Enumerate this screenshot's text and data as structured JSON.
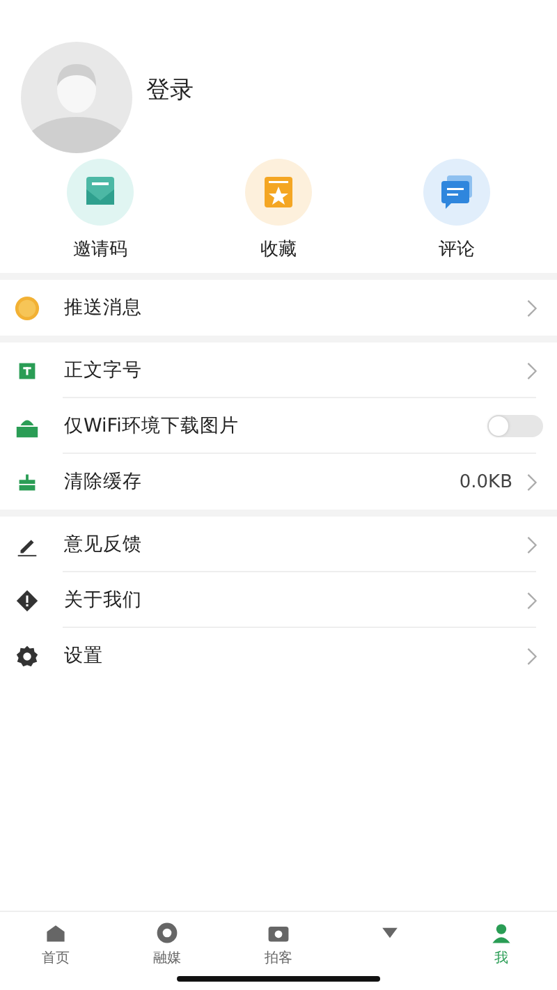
{
  "profile": {
    "login_label": "登录"
  },
  "shortcuts": [
    {
      "label": "邀请码"
    },
    {
      "label": "收藏"
    },
    {
      "label": "评论"
    }
  ],
  "menu_groups": [
    [
      {
        "kind": "link",
        "label": "推送消息"
      }
    ],
    [
      {
        "kind": "link",
        "label": "正文字号"
      },
      {
        "kind": "toggle",
        "label": "仅WiFi环境下载图片",
        "on": false
      },
      {
        "kind": "value",
        "label": "清除缓存",
        "value": "0.0KB"
      }
    ],
    [
      {
        "kind": "link",
        "label": "意见反馈"
      },
      {
        "kind": "link",
        "label": "关于我们"
      },
      {
        "kind": "link",
        "label": "设置"
      }
    ]
  ],
  "tab_bar": [
    {
      "label": "首页",
      "selected": false
    },
    {
      "label": "融媒",
      "selected": false
    },
    {
      "label": "拍客",
      "selected": false
    },
    {
      "selected": false
    },
    {
      "label": "我",
      "selected": true
    }
  ]
}
